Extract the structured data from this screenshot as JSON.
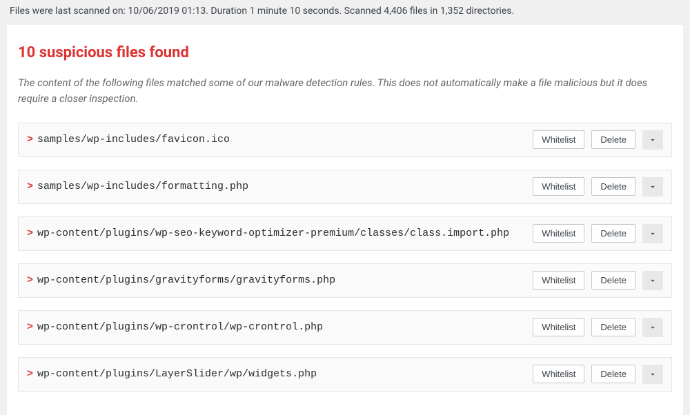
{
  "scan_info": "Files were last scanned on: 10/06/2019 01:13. Duration 1 minute 10 seconds. Scanned 4,406 files in 1,352 directories.",
  "heading": "10 suspicious files found",
  "description": "The content of the following files matched some of our malware detection rules. This does not automatically make a file malicious but it does require a closer inspection.",
  "arrow": ">",
  "buttons": {
    "whitelist": "Whitelist",
    "delete": "Delete"
  },
  "files": [
    {
      "path": "samples/wp-includes/favicon.ico"
    },
    {
      "path": "samples/wp-includes/formatting.php"
    },
    {
      "path": "wp-content/plugins/wp-seo-keyword-optimizer-premium/classes/class.import.php"
    },
    {
      "path": "wp-content/plugins/gravityforms/gravityforms.php"
    },
    {
      "path": "wp-content/plugins/wp-crontrol/wp-crontrol.php"
    },
    {
      "path": "wp-content/plugins/LayerSlider/wp/widgets.php"
    }
  ]
}
